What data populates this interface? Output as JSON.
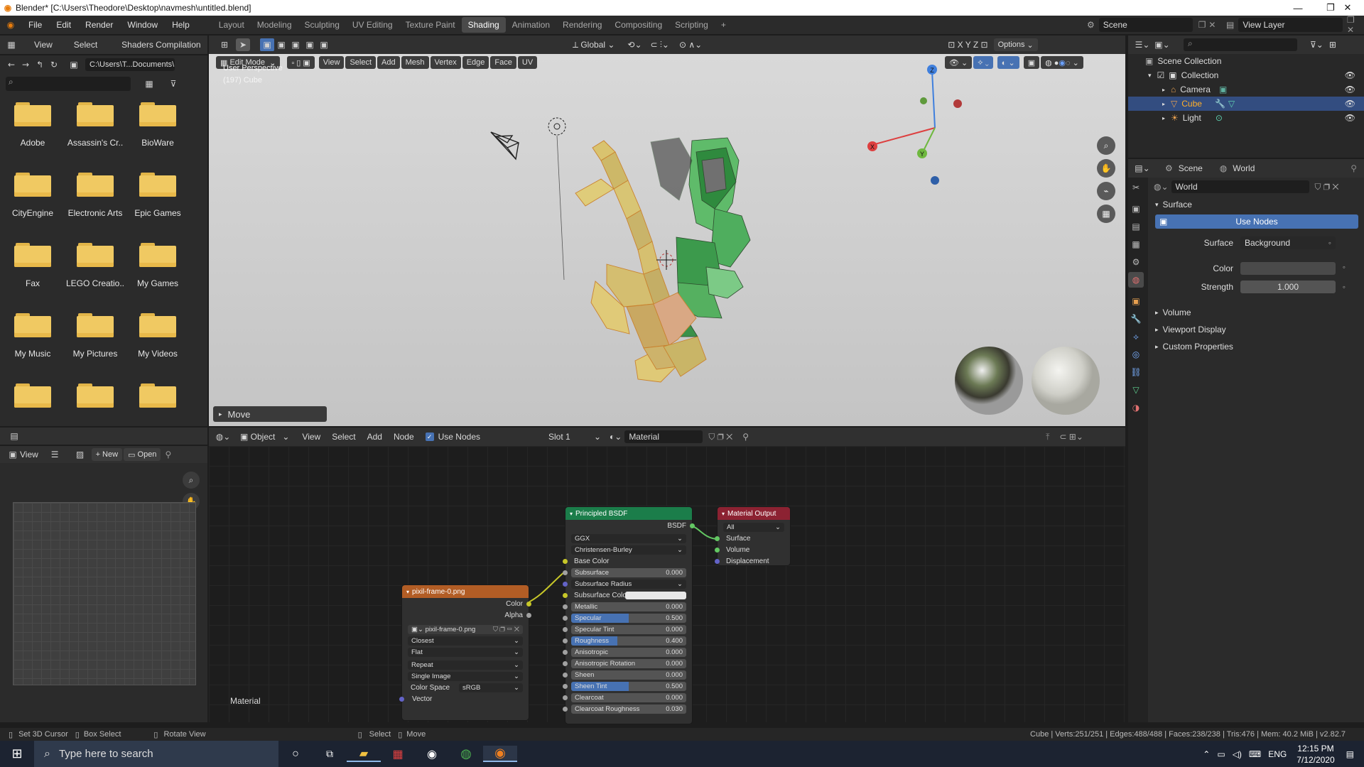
{
  "titlebar": {
    "title": "Blender* [C:\\Users\\Theodore\\Desktop\\navmesh\\untitled.blend]"
  },
  "menu": [
    "File",
    "Edit",
    "Render",
    "Window",
    "Help"
  ],
  "workspaces": [
    "Layout",
    "Modeling",
    "Sculpting",
    "UV Editing",
    "Texture Paint",
    "Shading",
    "Animation",
    "Rendering",
    "Compositing",
    "Scripting"
  ],
  "active_workspace": "Shading",
  "scene": {
    "scene_name": "Scene",
    "view_layer": "View Layer"
  },
  "filebrowser": {
    "header": [
      "View",
      "Select",
      "Shaders Compilation"
    ],
    "path": "C:\\Users\\T...Documents\\",
    "folders": [
      "Adobe",
      "Assassin's Cr..",
      "BioWare",
      "CityEngine",
      "Electronic Arts",
      "Epic Games",
      "Fax",
      "LEGO Creatio..",
      "My Games",
      "My Music",
      "My Pictures",
      "My Videos",
      "",
      "",
      ""
    ]
  },
  "viewport": {
    "header_left": {
      "transform": "Global",
      "options": "Options"
    },
    "mode": "Edit Mode",
    "menus": [
      "View",
      "Select",
      "Add",
      "Mesh",
      "Vertex",
      "Edge",
      "Face",
      "UV"
    ],
    "overlay_line1": "User Perspective",
    "overlay_line2": "(197) Cube",
    "last_op": "Move",
    "gizmo": {
      "x": "X",
      "y": "Y",
      "z": "Z"
    }
  },
  "imageeditor": {
    "view": "View",
    "new": "New",
    "open": "Open"
  },
  "nodeeditor": {
    "object": "Object",
    "menus": [
      "View",
      "Select",
      "Add",
      "Node"
    ],
    "use_nodes": "Use Nodes",
    "slot": "Slot 1",
    "material": "Material",
    "corner_label": "Material",
    "image_node": {
      "title": "pixil-frame-0.png",
      "outputs": [
        "Color",
        "Alpha"
      ],
      "image_name": "pixil-frame-0.png",
      "dropdowns": [
        "Closest",
        "Flat",
        "Repeat",
        "Single Image"
      ],
      "colorspace_label": "Color Space",
      "colorspace": "sRGB",
      "vector": "Vector"
    },
    "bsdf": {
      "title": "Principled BSDF",
      "output": "BSDF",
      "dist": "GGX",
      "sss": "Christensen-Burley",
      "base_color": "Base Color",
      "subsurface_radius": "Subsurface Radius",
      "subsurface_color": "Subsurface Color",
      "fields": [
        {
          "name": "Subsurface",
          "value": "0.000",
          "fill": 0
        },
        {
          "name": "Metallic",
          "value": "0.000",
          "fill": 0
        },
        {
          "name": "Specular",
          "value": "0.500",
          "fill": 0.5
        },
        {
          "name": "Specular Tint",
          "value": "0.000",
          "fill": 0
        },
        {
          "name": "Roughness",
          "value": "0.400",
          "fill": 0.4
        },
        {
          "name": "Anisotropic",
          "value": "0.000",
          "fill": 0
        },
        {
          "name": "Anisotropic Rotation",
          "value": "0.000",
          "fill": 0
        },
        {
          "name": "Sheen",
          "value": "0.000",
          "fill": 0
        },
        {
          "name": "Sheen Tint",
          "value": "0.500",
          "fill": 0.5
        },
        {
          "name": "Clearcoat",
          "value": "0.000",
          "fill": 0
        },
        {
          "name": "Clearcoat Roughness",
          "value": "0.030",
          "fill": 0.03
        }
      ]
    },
    "output_node": {
      "title": "Material Output",
      "target": "All",
      "inputs": [
        "Surface",
        "Volume",
        "Displacement"
      ]
    }
  },
  "outliner": {
    "root": "Scene Collection",
    "collection": "Collection",
    "items": [
      "Camera",
      "Cube",
      "Light"
    ]
  },
  "properties": {
    "tabs": [
      "Scene",
      "World"
    ],
    "world_name": "World",
    "surface_panel": "Surface",
    "use_nodes": "Use Nodes",
    "surface_label": "Surface",
    "surface_value": "Background",
    "color_label": "Color",
    "strength_label": "Strength",
    "strength_value": "1.000",
    "panels": [
      "Volume",
      "Viewport Display",
      "Custom Properties"
    ]
  },
  "statusbar": {
    "items": [
      "Set 3D Cursor",
      "Box Select",
      "Rotate View",
      "Select",
      "Move"
    ],
    "stats": "Cube | Verts:251/251 | Edges:488/488 | Faces:238/238 | Tris:476 | Mem: 40.2 MiB | v2.82.7"
  },
  "taskbar": {
    "search_placeholder": "Type here to search",
    "lang": "ENG",
    "time": "12:15 PM",
    "date": "7/12/2020"
  },
  "colors": {
    "accent": "#4772b3",
    "bsdf_header": "#1b7d4a",
    "texture_header": "#b25d25",
    "output_header": "#8c2232"
  }
}
